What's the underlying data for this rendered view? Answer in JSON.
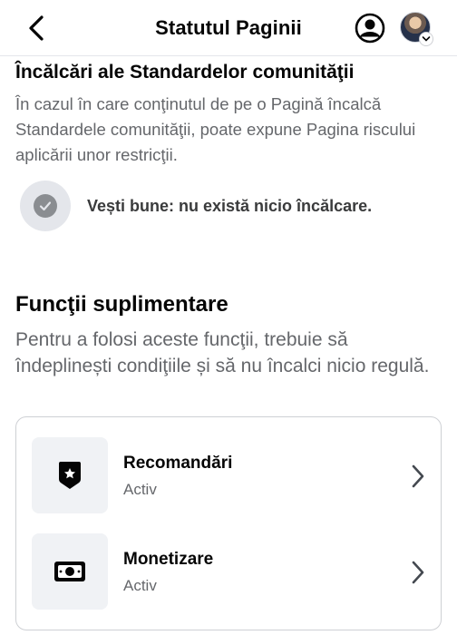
{
  "header": {
    "title": "Statutul Paginii",
    "back_icon": "chevron-left-icon",
    "profile_icon": "user-circle-icon",
    "avatar_badge_icon": "chevron-down-icon"
  },
  "violations": {
    "title": "Încălcări ale Standardelor comunităţii",
    "description": "În cazul în care conţinutul de pe o Pagină încalcă Standardele comunităţii, poate expune Pagina riscului aplicării unor restricţii.",
    "status_icon": "check-circle-icon",
    "status_text": "Vești bune: nu există nicio încălcare."
  },
  "features": {
    "title": "Funcţii suplimentare",
    "description": "Pentru a folosi aceste funcţii, trebuie să îndeplinești condiţiile și să nu încalci nicio regulă.",
    "items": [
      {
        "label": "Recomandări",
        "status": "Activ",
        "icon": "star-badge-icon"
      },
      {
        "label": "Monetizare",
        "status": "Activ",
        "icon": "money-icon"
      }
    ]
  },
  "colors": {
    "primary_text": "#050505",
    "secondary_text": "#65676b",
    "icon_bg": "#f0f2f5",
    "border": "#ced0d4"
  }
}
